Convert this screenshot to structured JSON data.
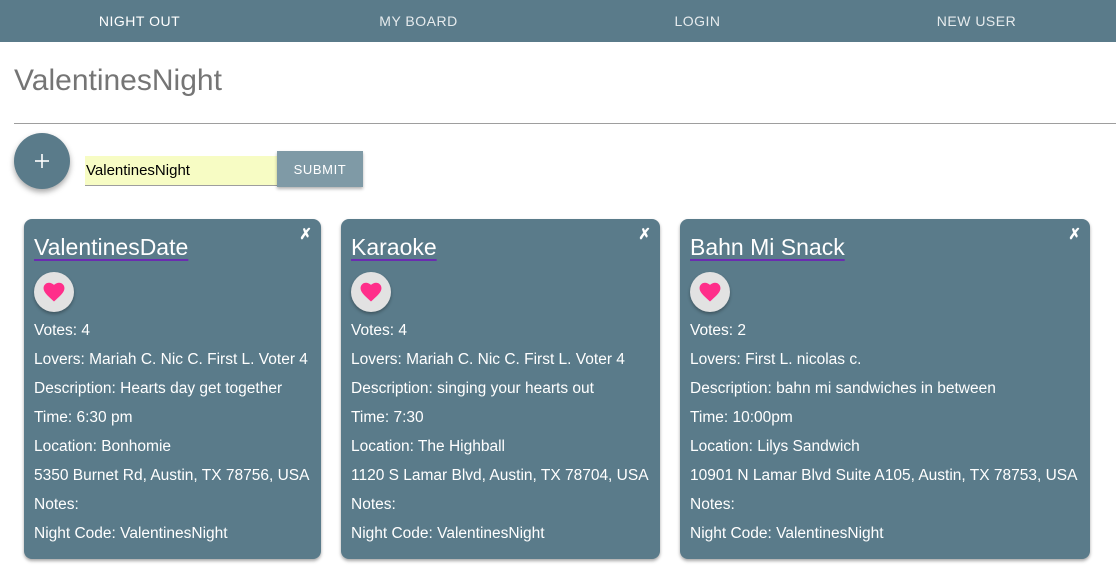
{
  "nav": {
    "brand": "NIGHT OUT",
    "my_board": "MY BOARD",
    "login": "LOGIN",
    "new_user": "NEW USER"
  },
  "page": {
    "title": "ValentinesNight"
  },
  "form": {
    "add_icon": "plus-icon",
    "code_value": "ValentinesNight",
    "submit_label": "SUBMIT"
  },
  "cards": [
    {
      "title": "ValentinesDate",
      "votes": "Votes: 4",
      "lovers": "Lovers: Mariah C. Nic C. First L. Voter 4",
      "description": "Description: Hearts day get together",
      "time": "Time: 6:30 pm",
      "location": "Location: Bonhomie",
      "address": "5350 Burnet Rd, Austin, TX 78756, USA",
      "notes": "Notes:",
      "night_code": "Night Code: ValentinesNight",
      "close_glyph": "✗"
    },
    {
      "title": "Karaoke",
      "votes": "Votes: 4",
      "lovers": "Lovers: Mariah C. Nic C. First L. Voter 4",
      "description": "Description: singing your hearts out",
      "time": "Time: 7:30",
      "location": "Location: The Highball",
      "address": "1120 S Lamar Blvd, Austin, TX 78704, USA",
      "notes": "Notes:",
      "night_code": "Night Code: ValentinesNight",
      "close_glyph": "✗"
    },
    {
      "title": "Bahn Mi Snack",
      "votes": "Votes: 2",
      "lovers": "Lovers: First L. nicolas c.",
      "description": "Description: bahn mi sandwiches in between",
      "time": "Time: 10:00pm",
      "location": "Location: Lilys Sandwich",
      "address": "10901 N Lamar Blvd Suite A105, Austin, TX 78753, USA",
      "notes": "Notes:",
      "night_code": "Night Code: ValentinesNight",
      "close_glyph": "✗"
    }
  ],
  "colors": {
    "primary": "#5a7b8a",
    "input_bg": "#f7fcc4",
    "heart": "#ff2e8a",
    "submit_bg": "#7f9aa6"
  }
}
